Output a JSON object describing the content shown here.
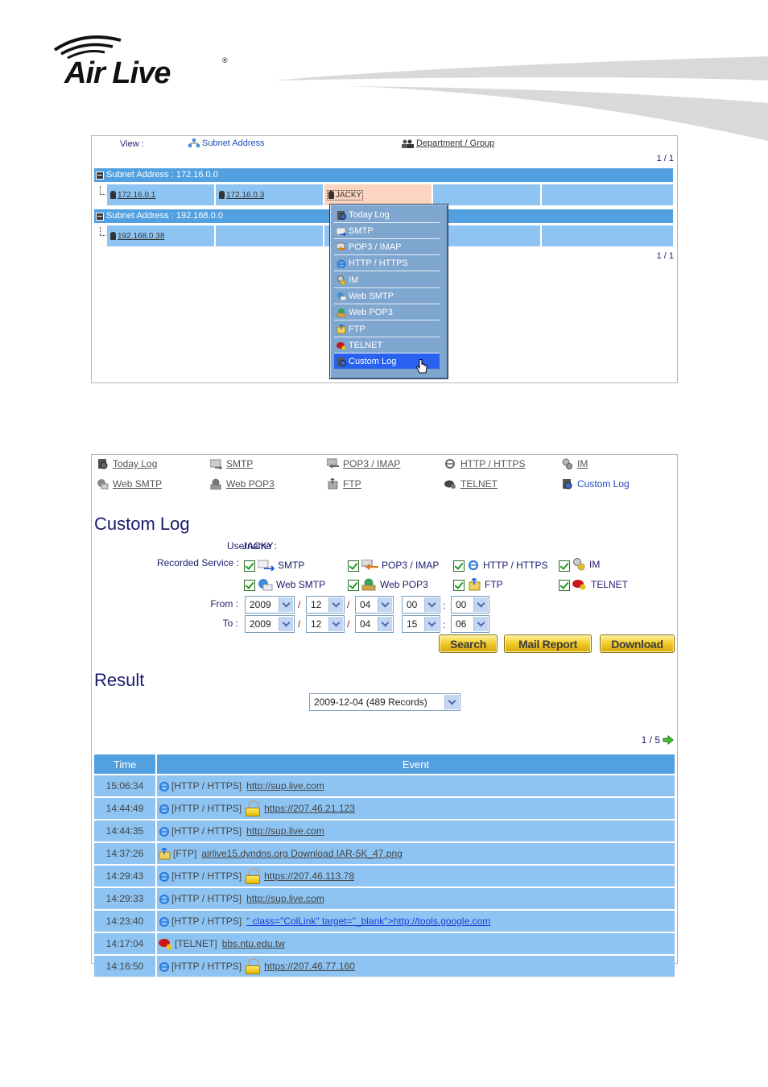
{
  "brand": {
    "name": "Air Live",
    "registered": "®"
  },
  "menu_panel": {
    "view_label": "View :",
    "view_options": [
      {
        "label": "Subnet Address",
        "icon": "network-icon",
        "active": true
      },
      {
        "label": "Department / Group",
        "icon": "group-icon",
        "active": false
      }
    ],
    "pager_top": "1 / 1",
    "pager_bottom": "1 / 1",
    "subnets": [
      {
        "title": "Subnet Address : 172.16.0.0",
        "hosts": [
          "172.16.0.1",
          "172.16.0.3",
          "JACKY"
        ]
      },
      {
        "title": "Subnet Address : 192.168.0.0",
        "hosts": [
          "192.168.0.38"
        ]
      }
    ],
    "context_menu": {
      "items": [
        {
          "label": "Today Log",
          "icon": "today-log-icon"
        },
        {
          "label": "SMTP",
          "icon": "smtp-icon"
        },
        {
          "label": "POP3 / IMAP",
          "icon": "pop3-icon"
        },
        {
          "label": "HTTP / HTTPS",
          "icon": "http-icon"
        },
        {
          "label": "IM",
          "icon": "im-icon"
        },
        {
          "label": "Web SMTP",
          "icon": "web-smtp-icon"
        },
        {
          "label": "Web POP3",
          "icon": "web-pop3-icon"
        },
        {
          "label": "FTP",
          "icon": "ftp-icon"
        },
        {
          "label": "TELNET",
          "icon": "telnet-icon"
        },
        {
          "label": "Custom Log",
          "icon": "custom-log-icon",
          "active": true
        }
      ]
    }
  },
  "log_panel": {
    "nav": [
      {
        "label": "Today Log",
        "icon": "today-log-icon"
      },
      {
        "label": "SMTP",
        "icon": "smtp-icon"
      },
      {
        "label": "POP3 / IMAP",
        "icon": "pop3-icon"
      },
      {
        "label": "HTTP / HTTPS",
        "icon": "http-icon"
      },
      {
        "label": "IM",
        "icon": "im-icon"
      },
      {
        "label": "Web SMTP",
        "icon": "web-smtp-icon"
      },
      {
        "label": "Web POP3",
        "icon": "web-pop3-icon"
      },
      {
        "label": "FTP",
        "icon": "ftp-icon"
      },
      {
        "label": "TELNET",
        "icon": "telnet-icon"
      },
      {
        "label": "Custom Log",
        "icon": "custom-log-icon",
        "active": true
      }
    ],
    "title": "Custom Log",
    "username_label": "Username :",
    "username": "JACKY",
    "recorded_service_label": "Recorded Service :",
    "services": [
      {
        "label": "SMTP",
        "checked": true
      },
      {
        "label": "POP3 / IMAP",
        "checked": true
      },
      {
        "label": "HTTP / HTTPS",
        "checked": true
      },
      {
        "label": "IM",
        "checked": true
      },
      {
        "label": "Web SMTP",
        "checked": true
      },
      {
        "label": "Web POP3",
        "checked": true
      },
      {
        "label": "FTP",
        "checked": true
      },
      {
        "label": "TELNET",
        "checked": true
      }
    ],
    "from_label": "From :",
    "to_label": "To :",
    "from": {
      "year": "2009",
      "month": "12",
      "day": "04",
      "hour": "00",
      "minute": "00"
    },
    "to": {
      "year": "2009",
      "month": "12",
      "day": "04",
      "hour": "15",
      "minute": "06"
    },
    "date_sep": "/",
    "time_sep": ":",
    "buttons": {
      "search": "Search",
      "mail_report": "Mail Report",
      "download": "Download"
    },
    "result_title": "Result",
    "result_select": "2009-12-04 (489 Records)",
    "pager": "1 / 5",
    "table": {
      "headers": [
        "Time",
        "Event"
      ],
      "rows": [
        {
          "time": "15:06:34",
          "type": "[HTTP / HTTPS]",
          "icon": "http-icon",
          "secure": false,
          "target": "http://sup.live.com"
        },
        {
          "time": "14:44:49",
          "type": "[HTTP / HTTPS]",
          "icon": "http-icon",
          "secure": true,
          "target": "https://207.46.21.123"
        },
        {
          "time": "14:44:35",
          "type": "[HTTP / HTTPS]",
          "icon": "http-icon",
          "secure": false,
          "target": "http://sup.live.com"
        },
        {
          "time": "14:37:26",
          "type": "[FTP]",
          "icon": "ftp-icon",
          "secure": false,
          "target": "airlive15.dyndns.org Download IAR-5K_47.png"
        },
        {
          "time": "14:29:43",
          "type": "[HTTP / HTTPS]",
          "icon": "http-icon",
          "secure": true,
          "target": "https://207.46.113.78"
        },
        {
          "time": "14:29:33",
          "type": "[HTTP / HTTPS]",
          "icon": "http-icon",
          "secure": false,
          "target": "http://sup.live.com"
        },
        {
          "time": "14:23:40",
          "type": "[HTTP / HTTPS]",
          "icon": "http-icon",
          "secure": false,
          "target": "\" class=\"ColLink\" target=\"_blank\">http://tools.google.com",
          "blue": true
        },
        {
          "time": "14:17:04",
          "type": "[TELNET]",
          "icon": "telnet-icon",
          "secure": false,
          "target": "bbs.ntu.edu.tw"
        },
        {
          "time": "14:16:50",
          "type": "[HTTP / HTTPS]",
          "icon": "http-icon",
          "secure": true,
          "target": "https://207.46.77.160"
        }
      ]
    }
  }
}
